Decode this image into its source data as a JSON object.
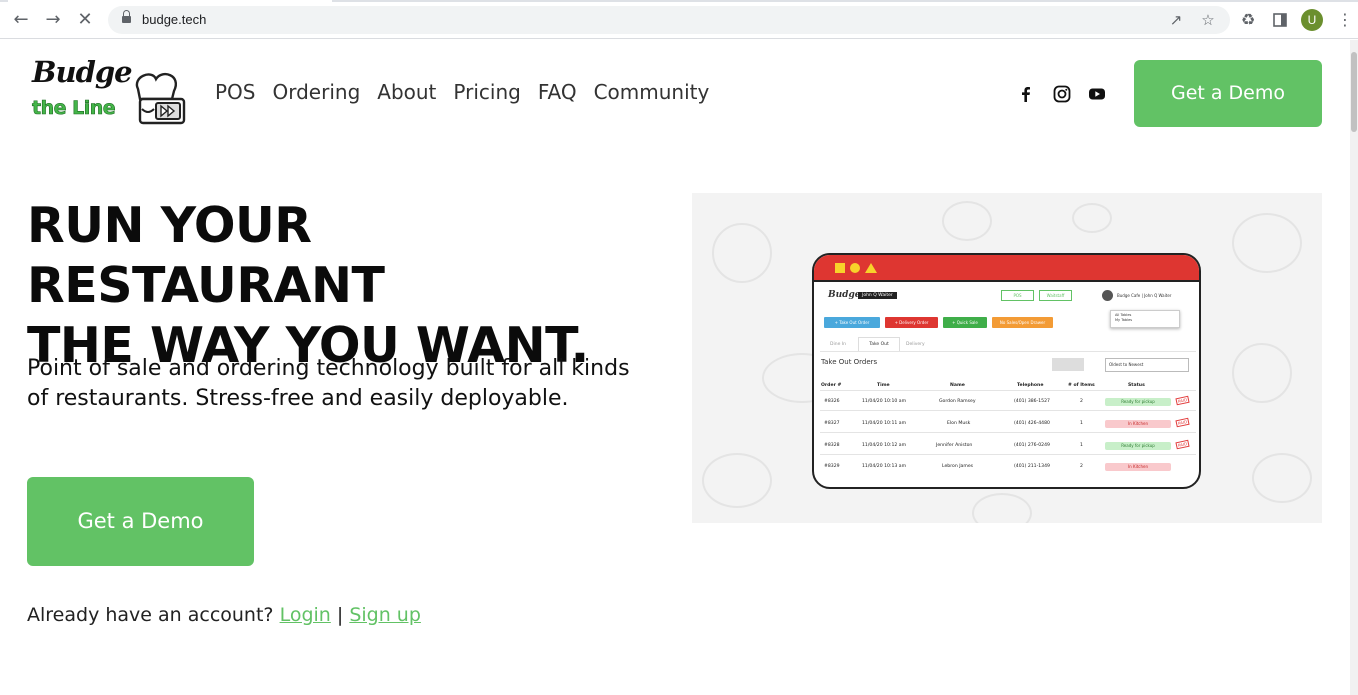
{
  "browser": {
    "url": "budge.tech",
    "avatar_initial": "U",
    "icons": [
      "back-icon",
      "forward-icon",
      "stop-icon",
      "lock-icon",
      "share-icon",
      "star-icon",
      "extensions-icon",
      "sidepanel-icon",
      "menu-icon"
    ]
  },
  "logo": {
    "line1": "Budge",
    "line2": "the Line"
  },
  "nav": {
    "items": [
      "POS",
      "Ordering",
      "About",
      "Pricing",
      "FAQ",
      "Community"
    ]
  },
  "header": {
    "demo_label": "Get a Demo"
  },
  "social": [
    "facebook-icon",
    "instagram-icon",
    "youtube-icon"
  ],
  "hero": {
    "title_line1": "RUN YOUR RESTAURANT",
    "title_line2": "THE WAY YOU WANT.",
    "subtitle": "Point of sale and ordering technology built for all kinds of restaurants. Stress-free and easily deployable.",
    "demo_label": "Get a Demo",
    "account_text": "Already have an account?",
    "login_label": "Login",
    "separator": "|",
    "signup_label": "Sign up"
  },
  "mockup": {
    "brand": "Budge",
    "waiter": "John Q Waiter",
    "tabs_top": [
      "POS",
      "Waitstaff"
    ],
    "user": "Budge Cafe  |  John Q Waiter",
    "actions": [
      "+ Take Out Order",
      "+ Delivery Order",
      "+ Quick Sale",
      "No Sales/Open Drawer"
    ],
    "tables_dropdown": [
      "All Tables",
      "My Tables"
    ],
    "subtabs": [
      "Dine In",
      "Take Out",
      "Delivery"
    ],
    "section_title": "Take Out Orders",
    "sort": "Oldest to Newest",
    "columns": [
      "Order #",
      "Time",
      "Name",
      "Telephone",
      "# of Items",
      "Status"
    ],
    "rows": [
      {
        "order": "#8326",
        "time": "11/04/20 10:10 am",
        "name": "Gordon Ramsey",
        "phone": "(401) 386-1527",
        "items": "2",
        "status": "Ready for pickup",
        "paid": "PAID"
      },
      {
        "order": "#8327",
        "time": "11/04/20 10:11 am",
        "name": "Elon Musk",
        "phone": "(401) 426-4480",
        "items": "1",
        "status": "In Kitchen",
        "paid": "PAID"
      },
      {
        "order": "#8328",
        "time": "11/04/20 10:12 am",
        "name": "Jennifer Aniston",
        "phone": "(401) 276-0249",
        "items": "1",
        "status": "Ready for pickup",
        "paid": "PAID"
      },
      {
        "order": "#8329",
        "time": "11/04/20 10:13 am",
        "name": "Lebron James",
        "phone": "(401) 211-1349",
        "items": "2",
        "status": "In Kitchen",
        "paid": ""
      }
    ],
    "colors": {
      "topbar": "#de3631",
      "ready": "#c8efc9",
      "kitchen": "#f9c9cc",
      "paid": "#e23b3b"
    }
  },
  "colors": {
    "brand_green": "#62c265",
    "text": "#0b0b0b"
  }
}
